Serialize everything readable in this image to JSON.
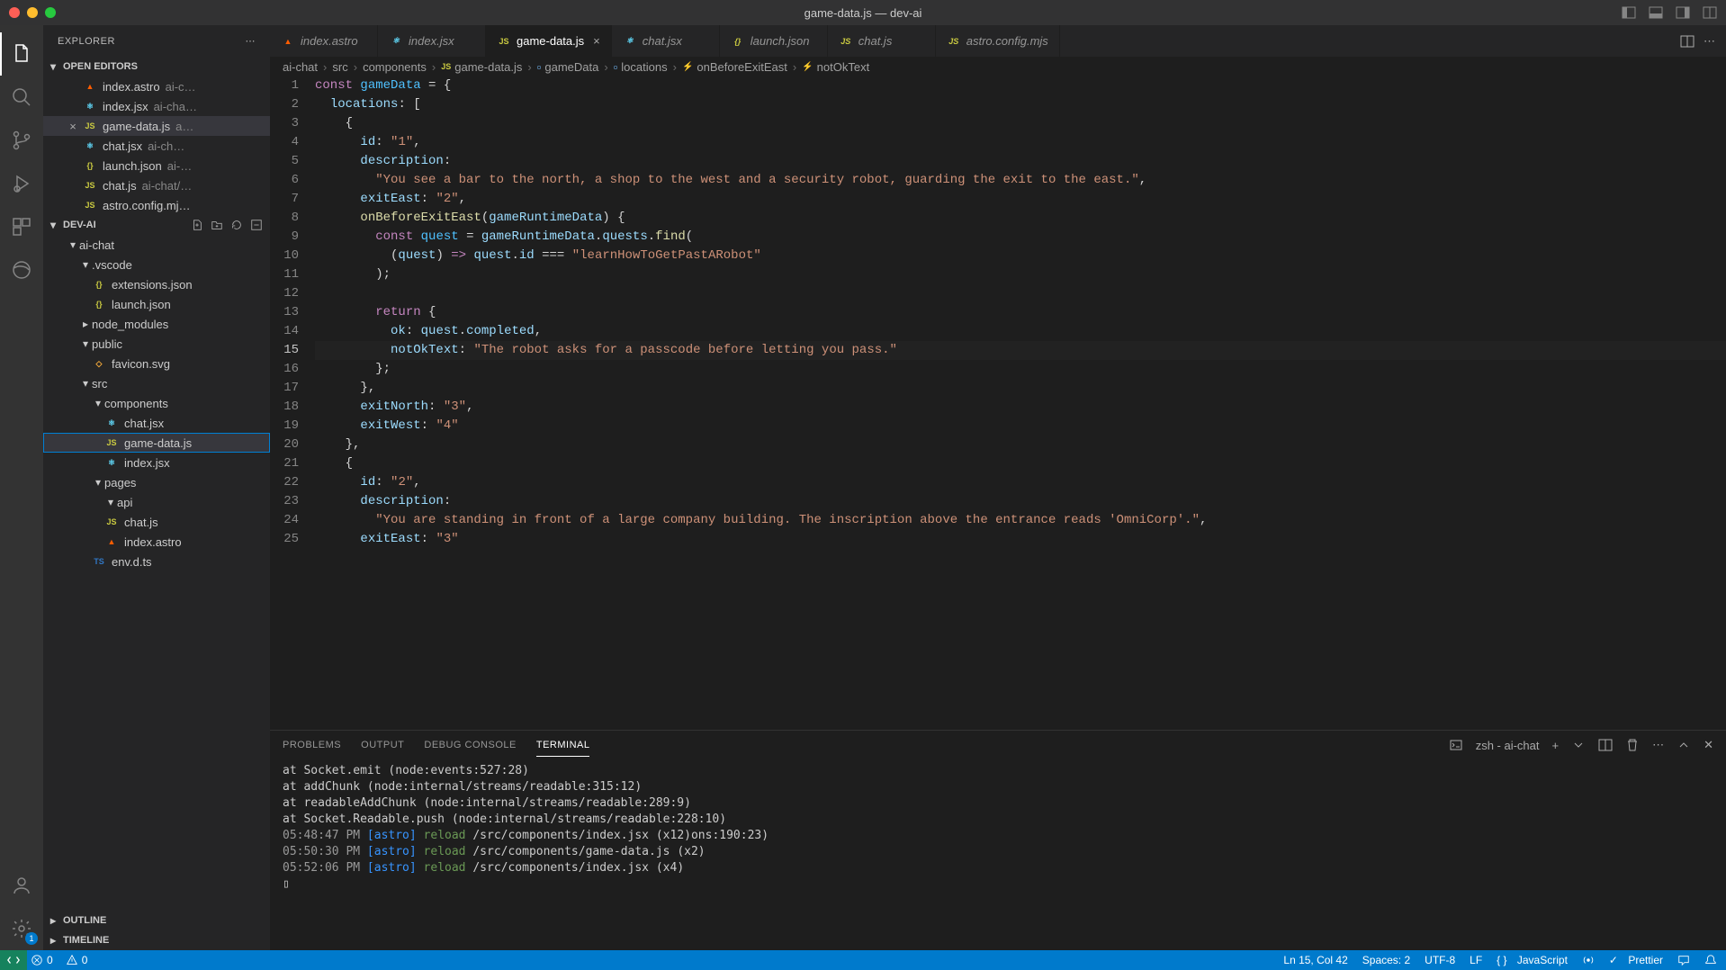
{
  "window": {
    "title": "game-data.js — dev-ai"
  },
  "sidebar": {
    "title": "EXPLORER",
    "openEditorsLabel": "OPEN EDITORS",
    "folderName": "DEV-AI",
    "outlineLabel": "OUTLINE",
    "timelineLabel": "TIMELINE",
    "openEditors": [
      {
        "name": "index.astro",
        "desc": "ai-c…",
        "icon": "astro"
      },
      {
        "name": "index.jsx",
        "desc": "ai-cha…",
        "icon": "react"
      },
      {
        "name": "game-data.js",
        "desc": "a…",
        "icon": "js",
        "active": true
      },
      {
        "name": "chat.jsx",
        "desc": "ai-ch…",
        "icon": "react"
      },
      {
        "name": "launch.json",
        "desc": "ai-…",
        "icon": "json"
      },
      {
        "name": "chat.js",
        "desc": "ai-chat/…",
        "icon": "js"
      },
      {
        "name": "astro.config.mj…",
        "desc": "",
        "icon": "js"
      }
    ],
    "tree": [
      {
        "name": "ai-chat",
        "kind": "folder",
        "indent": 1,
        "chev": "▾"
      },
      {
        "name": ".vscode",
        "kind": "folder",
        "indent": 2,
        "chev": "▾"
      },
      {
        "name": "extensions.json",
        "kind": "file",
        "indent": 3,
        "icon": "json"
      },
      {
        "name": "launch.json",
        "kind": "file",
        "indent": 3,
        "icon": "json"
      },
      {
        "name": "node_modules",
        "kind": "folder",
        "indent": 2,
        "chev": "▸"
      },
      {
        "name": "public",
        "kind": "folder",
        "indent": 2,
        "chev": "▾"
      },
      {
        "name": "favicon.svg",
        "kind": "file",
        "indent": 3,
        "icon": "svg"
      },
      {
        "name": "src",
        "kind": "folder",
        "indent": 2,
        "chev": "▾"
      },
      {
        "name": "components",
        "kind": "folder",
        "indent": 3,
        "chev": "▾"
      },
      {
        "name": "chat.jsx",
        "kind": "file",
        "indent": 4,
        "icon": "react"
      },
      {
        "name": "game-data.js",
        "kind": "file",
        "indent": 4,
        "icon": "js",
        "selected": true
      },
      {
        "name": "index.jsx",
        "kind": "file",
        "indent": 4,
        "icon": "react"
      },
      {
        "name": "pages",
        "kind": "folder",
        "indent": 3,
        "chev": "▾"
      },
      {
        "name": "api",
        "kind": "folder",
        "indent": 4,
        "chev": "▾"
      },
      {
        "name": "chat.js",
        "kind": "file",
        "indent": 4,
        "icon": "js"
      },
      {
        "name": "index.astro",
        "kind": "file",
        "indent": 4,
        "icon": "astro"
      },
      {
        "name": "env.d.ts",
        "kind": "file",
        "indent": 3,
        "icon": "ts"
      }
    ]
  },
  "tabs": [
    {
      "name": "index.astro",
      "icon": "astro",
      "italic": true
    },
    {
      "name": "index.jsx",
      "icon": "react",
      "italic": true
    },
    {
      "name": "game-data.js",
      "icon": "js",
      "active": true
    },
    {
      "name": "chat.jsx",
      "icon": "react",
      "italic": true
    },
    {
      "name": "launch.json",
      "icon": "json",
      "italic": true
    },
    {
      "name": "chat.js",
      "icon": "js",
      "italic": true
    },
    {
      "name": "astro.config.mjs",
      "icon": "js",
      "italic": true
    }
  ],
  "breadcrumbs": [
    {
      "label": "ai-chat"
    },
    {
      "label": "src"
    },
    {
      "label": "components"
    },
    {
      "label": "game-data.js",
      "icon": "js"
    },
    {
      "label": "gameData",
      "icon": "var"
    },
    {
      "label": "locations",
      "icon": "var"
    },
    {
      "label": "onBeforeExitEast",
      "icon": "fn"
    },
    {
      "label": "notOkText",
      "icon": "fn"
    }
  ],
  "editor": {
    "currentLine": 15,
    "lines": 25
  },
  "panel": {
    "tabs": {
      "problems": "PROBLEMS",
      "output": "OUTPUT",
      "debug": "DEBUG CONSOLE",
      "terminal": "TERMINAL"
    },
    "termLabel": "zsh - ai-chat",
    "terminalLines": [
      {
        "plain": "    at Socket.emit (node:events:527:28)"
      },
      {
        "plain": "    at addChunk (node:internal/streams/readable:315:12)"
      },
      {
        "plain": "    at readableAddChunk (node:internal/streams/readable:289:9)"
      },
      {
        "plain": "    at Socket.Readable.push (node:internal/streams/readable:228:10)"
      },
      {
        "time": "05:48:47 PM",
        "tag": "[astro]",
        "kw": "reload",
        "rest": "/src/components/index.jsx (x12)ons:190:23)"
      },
      {
        "time": "05:50:30 PM",
        "tag": "[astro]",
        "kw": "reload",
        "rest": "/src/components/game-data.js (x2)"
      },
      {
        "time": "05:52:06 PM",
        "tag": "[astro]",
        "kw": "reload",
        "rest": "/src/components/index.jsx (x4)"
      }
    ],
    "cursor": "▯"
  },
  "status": {
    "remoteBadge": "1",
    "errors": "0",
    "warnings": "0",
    "lncol": "Ln 15, Col 42",
    "spaces": "Spaces: 2",
    "encoding": "UTF-8",
    "eol": "LF",
    "lang": "JavaScript",
    "prettier": "Prettier"
  }
}
